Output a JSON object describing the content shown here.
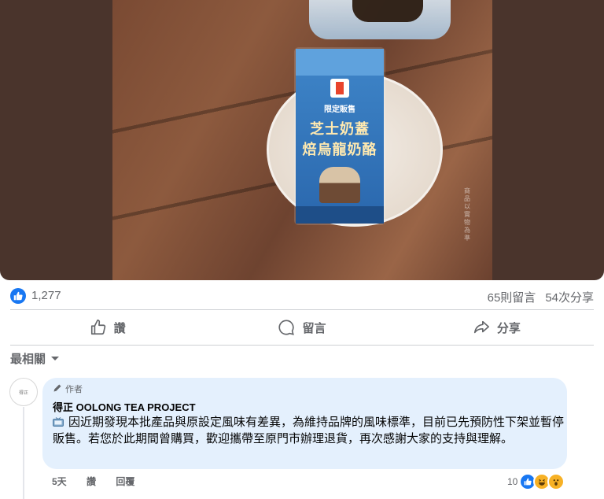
{
  "photo": {
    "label_brand": "7 ELEVEN",
    "label_limited": "限定販售",
    "label_line1": "芝士奶蓋",
    "label_line2": "焙烏龍奶酪",
    "side_text": "商品以實物為準"
  },
  "stats": {
    "like_count": "1,277",
    "comments": "65則留言",
    "shares": "54次分享"
  },
  "actions": {
    "like": "讚",
    "comment": "留言",
    "share": "分享"
  },
  "sort": {
    "label": "最相關"
  },
  "comment": {
    "author_tag": "作者",
    "author_name": "得正 OOLONG TEA PROJECT",
    "avatar_text": "得正",
    "text": "因近期發現本批產品與原設定風味有差異，為維持品牌的風味標準，目前已先預防性下架並暫停販售。若您於此期間曾購買，歡迎攜帶至原門市辦理退貨，再次感謝大家的支持與理解。",
    "time": "5天",
    "like_action": "讚",
    "reply_action": "回覆",
    "reaction_count": "10"
  },
  "colors": {
    "accent": "#1877f2",
    "bubble": "#e4f0fd",
    "muted_text": "#65676b"
  }
}
